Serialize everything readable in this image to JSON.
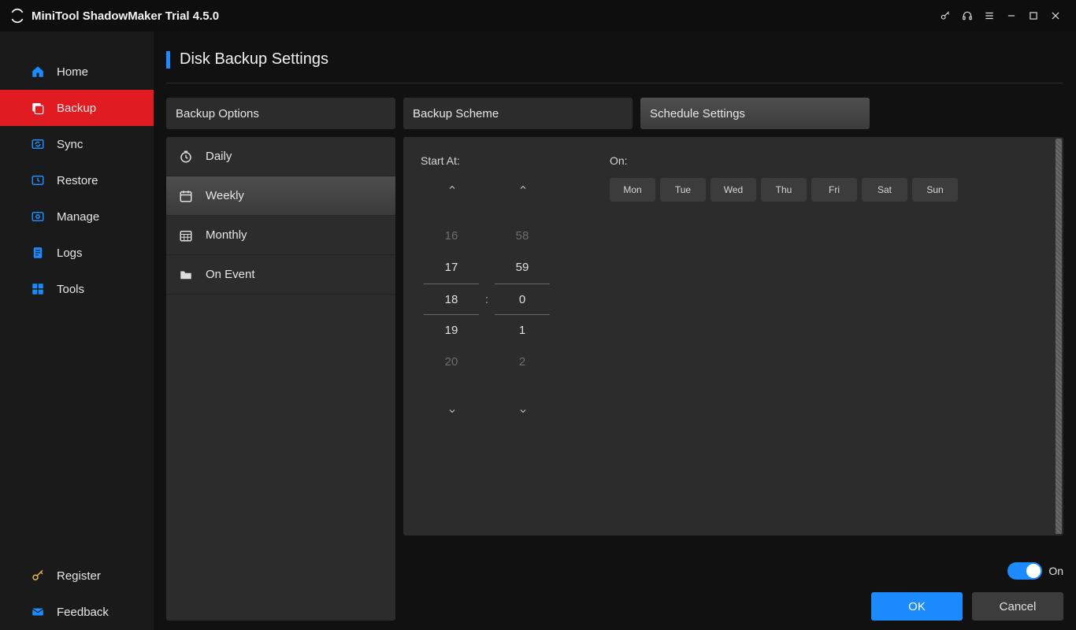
{
  "title": "MiniTool ShadowMaker Trial 4.5.0",
  "sidebar": {
    "items": [
      {
        "label": "Home"
      },
      {
        "label": "Backup"
      },
      {
        "label": "Sync"
      },
      {
        "label": "Restore"
      },
      {
        "label": "Manage"
      },
      {
        "label": "Logs"
      },
      {
        "label": "Tools"
      }
    ],
    "bottom": [
      {
        "label": "Register"
      },
      {
        "label": "Feedback"
      }
    ]
  },
  "page": {
    "heading": "Disk Backup Settings"
  },
  "tabs": {
    "options": "Backup Options",
    "scheme": "Backup Scheme",
    "schedule": "Schedule Settings"
  },
  "schedule_modes": {
    "daily": "Daily",
    "weekly": "Weekly",
    "monthly": "Monthly",
    "onevent": "On Event"
  },
  "schedule_panel": {
    "start_at": "Start At:",
    "on": "On:",
    "hours": {
      "m2": "16",
      "m1": "17",
      "sel": "18",
      "p1": "19",
      "p2": "20"
    },
    "minutes": {
      "m2": "58",
      "m1": "59",
      "sel": "0",
      "p1": "1",
      "p2": "2"
    },
    "colon": ":",
    "days": [
      "Mon",
      "Tue",
      "Wed",
      "Thu",
      "Fri",
      "Sat",
      "Sun"
    ]
  },
  "footer": {
    "toggle_label": "On",
    "ok": "OK",
    "cancel": "Cancel"
  },
  "colors": {
    "accent": "#1c8bff",
    "danger": "#e11b22"
  }
}
